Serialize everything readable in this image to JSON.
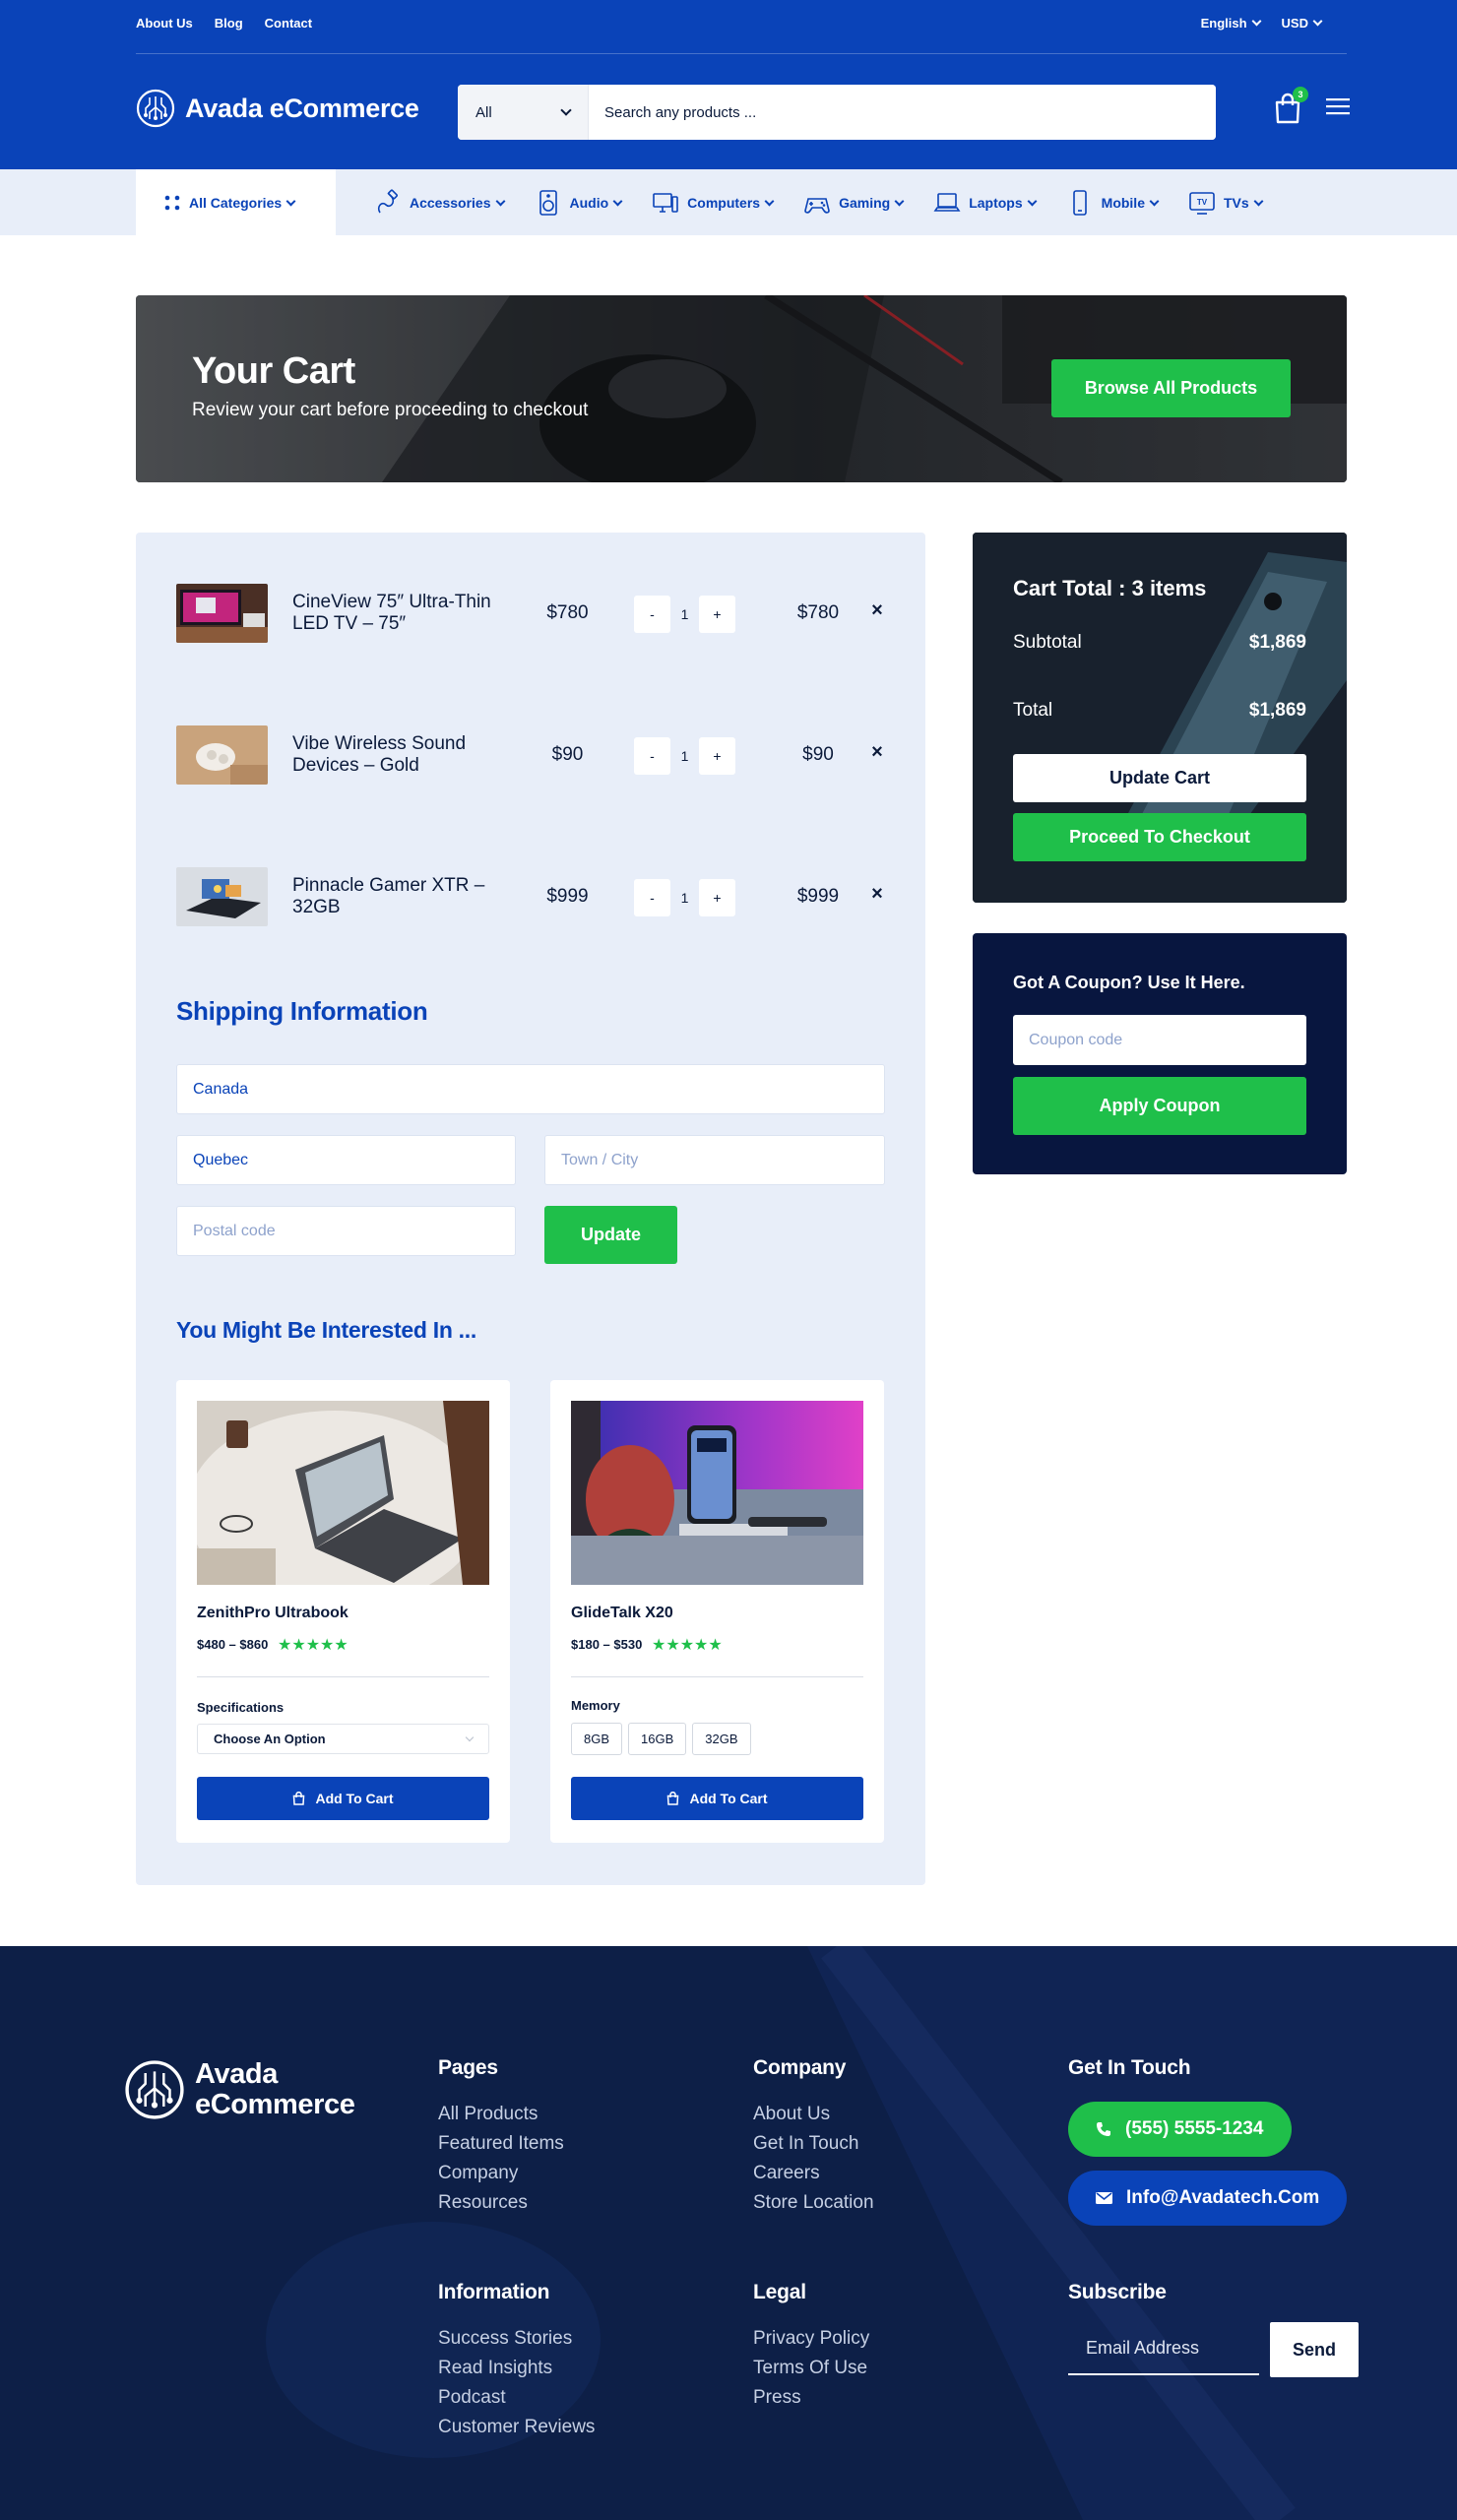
{
  "colors": {
    "primary": "#0a43b8",
    "accent": "#1fbf4a",
    "dark": "#08163f",
    "footer": "#0d1f47",
    "nav_bg": "#e8eef9"
  },
  "topbar": {
    "links": [
      "About Us",
      "Blog",
      "Contact"
    ],
    "language": "English",
    "currency": "USD"
  },
  "header": {
    "brand": "Avada eCommerce",
    "search_category": "All",
    "search_placeholder": "Search any products ...",
    "cart_count": "3"
  },
  "nav": {
    "all_categories": "All Categories",
    "items": [
      {
        "label": "Accessories",
        "icon": "accessories-icon"
      },
      {
        "label": "Audio",
        "icon": "speaker-icon"
      },
      {
        "label": "Computers",
        "icon": "computer-icon"
      },
      {
        "label": "Gaming",
        "icon": "gamepad-icon"
      },
      {
        "label": "Laptops",
        "icon": "laptop-icon"
      },
      {
        "label": "Mobile",
        "icon": "mobile-icon"
      },
      {
        "label": "TVs",
        "icon": "tv-icon"
      }
    ]
  },
  "hero": {
    "title": "Your Cart",
    "subtitle": "Review your cart before proceeding to checkout",
    "button": "Browse All Products"
  },
  "cart": {
    "items": [
      {
        "name": "CineView 75″ Ultra-Thin LED TV – 75″",
        "price": "$780",
        "qty": "1",
        "total": "$780"
      },
      {
        "name": "Vibe Wireless Sound Devices – Gold",
        "price": "$90",
        "qty": "1",
        "total": "$90"
      },
      {
        "name": "Pinnacle Gamer XTR – 32GB",
        "price": "$999",
        "qty": "1",
        "total": "$999"
      }
    ],
    "minus": "-",
    "plus": "+",
    "remove": "×"
  },
  "shipping": {
    "title": "Shipping Information",
    "country": "Canada",
    "state": "Quebec",
    "city_placeholder": "Town / City",
    "postal_placeholder": "Postal code",
    "update": "Update"
  },
  "interested": {
    "title": "You Might Be Interested In ...",
    "products": [
      {
        "name": "ZenithPro Ultrabook",
        "price": "$480 – $860",
        "rating": 5,
        "option_label": "Specifications",
        "option_value": "Choose An Option",
        "button": "Add To Cart"
      },
      {
        "name": "GlideTalk X20",
        "price": "$180 – $530",
        "rating": 5,
        "option_label": "Memory",
        "swatches": [
          "8GB",
          "16GB",
          "32GB"
        ],
        "button": "Add To Cart"
      }
    ]
  },
  "totals": {
    "title": "Cart Total : 3 items",
    "subtotal_label": "Subtotal",
    "subtotal": "$1,869",
    "total_label": "Total",
    "total": "$1,869",
    "update": "Update Cart",
    "checkout": "Proceed To Checkout"
  },
  "coupon": {
    "title": "Got A Coupon? Use It Here.",
    "placeholder": "Coupon code",
    "button": "Apply Coupon"
  },
  "footer": {
    "brand_line1": "Avada",
    "brand_line2": "eCommerce",
    "pages": {
      "title": "Pages",
      "links": [
        "All Products",
        "Featured Items",
        "Company",
        "Resources"
      ]
    },
    "company": {
      "title": "Company",
      "links": [
        "About Us",
        "Get In Touch",
        "Careers",
        "Store Location"
      ]
    },
    "contact": {
      "title": "Get In Touch",
      "phone": "(555) 5555-1234",
      "email": "Info@Avadatech.Com"
    },
    "information": {
      "title": "Information",
      "links": [
        "Success Stories",
        "Read Insights",
        "Podcast",
        "Customer Reviews"
      ]
    },
    "legal": {
      "title": "Legal",
      "links": [
        "Privacy Policy",
        "Terms Of Use",
        "Press"
      ]
    },
    "subscribe": {
      "title": "Subscribe",
      "placeholder": "Email Address",
      "button": "Send"
    }
  }
}
